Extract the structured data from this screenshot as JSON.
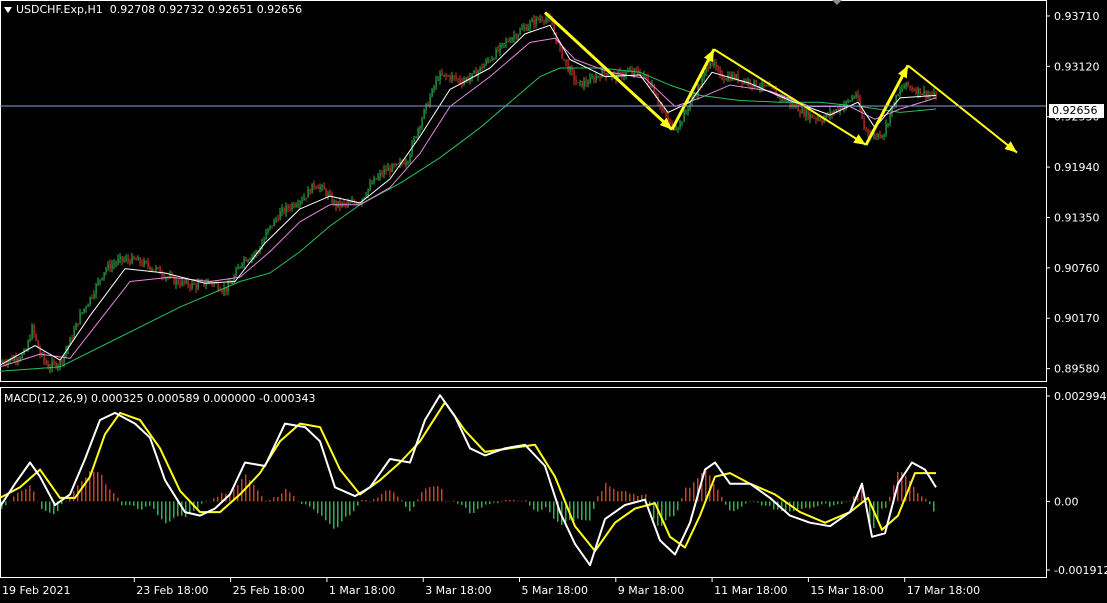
{
  "header": {
    "symbol": "USDCHF.Exp,H1",
    "ohlc": "0.92708 0.92732 0.92651 0.92656"
  },
  "macd_header": "MACD(12,26,9) 0.000325 0.000589 0.000000 -0.000343",
  "current_price": "0.92656",
  "colors": {
    "background": "#000000",
    "grid": "#ffffff",
    "bull_candle": "#2fb34a",
    "bear_candle": "#d43a2a",
    "ma_fast": "#ffffff",
    "ma_pink": "#e58adf",
    "ma_slow": "#25c25a",
    "arrow": "#ffff1a",
    "price_line": "#8a9bd8",
    "macd_line": "#ffffff",
    "signal_line": "#ffff1a"
  },
  "chart_data": [
    {
      "type": "candlestick",
      "title": "",
      "y_ticks": [
        "0.93710",
        "0.93120",
        "0.92530",
        "0.91940",
        "0.91350",
        "0.90760",
        "0.90170",
        "0.89580"
      ],
      "ylim": [
        0.8947,
        0.9385
      ],
      "x_ticks": [
        "19 Feb 2021",
        "23 Feb 18:00",
        "25 Feb 18:00",
        "1 Mar 18:00",
        "3 Mar 18:00",
        "5 Mar 18:00",
        "9 Mar 18:00",
        "11 Mar 18:00",
        "15 Mar 18:00",
        "17 Mar 18:00"
      ],
      "close_path": [
        [
          0,
          0.8965
        ],
        [
          25,
          0.8975
        ],
        [
          32,
          0.9005
        ],
        [
          40,
          0.8975
        ],
        [
          48,
          0.896
        ],
        [
          60,
          0.8965
        ],
        [
          70,
          0.899
        ],
        [
          80,
          0.902
        ],
        [
          92,
          0.9045
        ],
        [
          105,
          0.9075
        ],
        [
          120,
          0.9085
        ],
        [
          135,
          0.9085
        ],
        [
          155,
          0.9075
        ],
        [
          175,
          0.906
        ],
        [
          195,
          0.9055
        ],
        [
          210,
          0.906
        ],
        [
          225,
          0.905
        ],
        [
          232,
          0.906
        ],
        [
          242,
          0.9085
        ],
        [
          258,
          0.9095
        ],
        [
          268,
          0.912
        ],
        [
          280,
          0.914
        ],
        [
          292,
          0.915
        ],
        [
          305,
          0.916
        ],
        [
          315,
          0.9175
        ],
        [
          325,
          0.9165
        ],
        [
          335,
          0.915
        ],
        [
          348,
          0.915
        ],
        [
          360,
          0.9155
        ],
        [
          372,
          0.9175
        ],
        [
          385,
          0.919
        ],
        [
          398,
          0.9195
        ],
        [
          408,
          0.9205
        ],
        [
          418,
          0.924
        ],
        [
          428,
          0.927
        ],
        [
          438,
          0.93
        ],
        [
          450,
          0.93
        ],
        [
          462,
          0.9295
        ],
        [
          472,
          0.93
        ],
        [
          485,
          0.9315
        ],
        [
          498,
          0.933
        ],
        [
          510,
          0.9345
        ],
        [
          522,
          0.9355
        ],
        [
          534,
          0.9365
        ],
        [
          545,
          0.937
        ],
        [
          552,
          0.936
        ],
        [
          560,
          0.933
        ],
        [
          568,
          0.931
        ],
        [
          578,
          0.929
        ],
        [
          590,
          0.9295
        ],
        [
          602,
          0.9305
        ],
        [
          615,
          0.93
        ],
        [
          628,
          0.9305
        ],
        [
          640,
          0.9305
        ],
        [
          652,
          0.929
        ],
        [
          662,
          0.926
        ],
        [
          672,
          0.924
        ],
        [
          680,
          0.9245
        ],
        [
          690,
          0.927
        ],
        [
          700,
          0.929
        ],
        [
          710,
          0.932
        ],
        [
          720,
          0.93
        ],
        [
          732,
          0.93
        ],
        [
          745,
          0.9295
        ],
        [
          758,
          0.929
        ],
        [
          770,
          0.9285
        ],
        [
          782,
          0.9275
        ],
        [
          795,
          0.9265
        ],
        [
          808,
          0.9255
        ],
        [
          822,
          0.925
        ],
        [
          835,
          0.926
        ],
        [
          848,
          0.927
        ],
        [
          856,
          0.928
        ],
        [
          864,
          0.924
        ],
        [
          874,
          0.923
        ],
        [
          884,
          0.9235
        ],
        [
          894,
          0.927
        ],
        [
          904,
          0.929
        ],
        [
          915,
          0.9285
        ],
        [
          926,
          0.928
        ],
        [
          936,
          0.9276
        ]
      ],
      "ma_slow_path": [
        [
          0,
          0.8955
        ],
        [
          60,
          0.896
        ],
        [
          120,
          0.8995
        ],
        [
          180,
          0.903
        ],
        [
          240,
          0.906
        ],
        [
          270,
          0.907
        ],
        [
          300,
          0.9095
        ],
        [
          330,
          0.9125
        ],
        [
          360,
          0.915
        ],
        [
          400,
          0.9175
        ],
        [
          440,
          0.9205
        ],
        [
          480,
          0.924
        ],
        [
          510,
          0.927
        ],
        [
          540,
          0.93
        ],
        [
          560,
          0.931
        ],
        [
          600,
          0.931
        ],
        [
          640,
          0.9305
        ],
        [
          670,
          0.929
        ],
        [
          700,
          0.9278
        ],
        [
          740,
          0.9272
        ],
        [
          780,
          0.927
        ],
        [
          820,
          0.927
        ],
        [
          860,
          0.9265
        ],
        [
          900,
          0.9258
        ],
        [
          936,
          0.9262
        ]
      ],
      "ma_pink_path": [
        [
          0,
          0.896
        ],
        [
          40,
          0.8975
        ],
        [
          70,
          0.897
        ],
        [
          100,
          0.9015
        ],
        [
          130,
          0.906
        ],
        [
          170,
          0.9065
        ],
        [
          210,
          0.906
        ],
        [
          240,
          0.9065
        ],
        [
          270,
          0.9095
        ],
        [
          300,
          0.913
        ],
        [
          330,
          0.915
        ],
        [
          360,
          0.915
        ],
        [
          390,
          0.917
        ],
        [
          420,
          0.921
        ],
        [
          450,
          0.9265
        ],
        [
          490,
          0.93
        ],
        [
          530,
          0.934
        ],
        [
          555,
          0.9345
        ],
        [
          575,
          0.932
        ],
        [
          610,
          0.9305
        ],
        [
          645,
          0.9298
        ],
        [
          675,
          0.9265
        ],
        [
          700,
          0.9275
        ],
        [
          730,
          0.929
        ],
        [
          770,
          0.9283
        ],
        [
          810,
          0.9265
        ],
        [
          850,
          0.9265
        ],
        [
          875,
          0.925
        ],
        [
          900,
          0.9262
        ],
        [
          936,
          0.9275
        ]
      ],
      "ma_white_path": [
        [
          0,
          0.8962
        ],
        [
          35,
          0.8985
        ],
        [
          60,
          0.8968
        ],
        [
          90,
          0.902
        ],
        [
          125,
          0.9075
        ],
        [
          165,
          0.907
        ],
        [
          205,
          0.9058
        ],
        [
          235,
          0.906
        ],
        [
          265,
          0.9105
        ],
        [
          300,
          0.9145
        ],
        [
          330,
          0.916
        ],
        [
          360,
          0.9152
        ],
        [
          390,
          0.918
        ],
        [
          420,
          0.923
        ],
        [
          450,
          0.9285
        ],
        [
          490,
          0.931
        ],
        [
          525,
          0.935
        ],
        [
          550,
          0.936
        ],
        [
          570,
          0.932
        ],
        [
          605,
          0.93
        ],
        [
          640,
          0.9302
        ],
        [
          668,
          0.9258
        ],
        [
          690,
          0.927
        ],
        [
          712,
          0.9305
        ],
        [
          750,
          0.9292
        ],
        [
          790,
          0.9272
        ],
        [
          830,
          0.9255
        ],
        [
          858,
          0.927
        ],
        [
          875,
          0.924
        ],
        [
          900,
          0.9275
        ],
        [
          936,
          0.9278
        ]
      ],
      "arrows": [
        {
          "from": [
            545,
            0.9375
          ],
          "to": [
            672,
            0.9238
          ]
        },
        {
          "from": [
            672,
            0.9238
          ],
          "to": [
            714,
            0.9332
          ]
        },
        {
          "from": [
            714,
            0.9332
          ],
          "to": [
            866,
            0.922
          ]
        },
        {
          "from": [
            866,
            0.922
          ],
          "to": [
            908,
            0.9313
          ]
        },
        {
          "from": [
            908,
            0.9313
          ],
          "to": [
            1017,
            0.9211
          ]
        }
      ]
    },
    {
      "type": "macd",
      "y_ticks": [
        "0.002994",
        "0.00",
        "-0.001912"
      ],
      "ylim": [
        -0.00205,
        0.00312
      ],
      "histogram_step": 4,
      "macd_path": [
        [
          0,
          -0.00015
        ],
        [
          15,
          0.0005
        ],
        [
          30,
          0.0011
        ],
        [
          40,
          0.0007
        ],
        [
          55,
          -0.0001
        ],
        [
          70,
          0.0002
        ],
        [
          85,
          0.0012
        ],
        [
          100,
          0.0023
        ],
        [
          115,
          0.0025
        ],
        [
          135,
          0.0022
        ],
        [
          150,
          0.0018
        ],
        [
          165,
          0.0006
        ],
        [
          185,
          -0.0003
        ],
        [
          200,
          -0.0004
        ],
        [
          215,
          -0.0002
        ],
        [
          230,
          0.0002
        ],
        [
          245,
          0.0011
        ],
        [
          265,
          0.001
        ],
        [
          285,
          0.0022
        ],
        [
          305,
          0.0021
        ],
        [
          320,
          0.0017
        ],
        [
          335,
          0.0004
        ],
        [
          355,
          0.00015
        ],
        [
          370,
          0.0004
        ],
        [
          390,
          0.0012
        ],
        [
          410,
          0.0011
        ],
        [
          425,
          0.0023
        ],
        [
          440,
          0.003
        ],
        [
          455,
          0.0024
        ],
        [
          470,
          0.0015
        ],
        [
          485,
          0.0013
        ],
        [
          505,
          0.0015
        ],
        [
          525,
          0.0016
        ],
        [
          545,
          0.001
        ],
        [
          560,
          -0.0003
        ],
        [
          575,
          -0.0012
        ],
        [
          590,
          -0.0018
        ],
        [
          605,
          -0.0005
        ],
        [
          625,
          -0.0001
        ],
        [
          645,
          5e-05
        ],
        [
          660,
          -0.0011
        ],
        [
          675,
          -0.0015
        ],
        [
          690,
          -0.0006
        ],
        [
          705,
          0.0009
        ],
        [
          715,
          0.0011
        ],
        [
          730,
          0.0005
        ],
        [
          750,
          0.0005
        ],
        [
          770,
          0.0001
        ],
        [
          790,
          -0.0004
        ],
        [
          810,
          -0.0006
        ],
        [
          830,
          -0.0007
        ],
        [
          850,
          -0.0003
        ],
        [
          862,
          0.0005
        ],
        [
          872,
          -0.001
        ],
        [
          885,
          -0.0009
        ],
        [
          898,
          0.0005
        ],
        [
          912,
          0.0011
        ],
        [
          925,
          0.0009
        ],
        [
          936,
          0.0004
        ]
      ],
      "signal_path": [
        [
          0,
          0.0001
        ],
        [
          20,
          0.0004
        ],
        [
          40,
          0.0009
        ],
        [
          60,
          0.0001
        ],
        [
          75,
          0.0001
        ],
        [
          90,
          0.0007
        ],
        [
          105,
          0.0019
        ],
        [
          120,
          0.0025
        ],
        [
          140,
          0.0023
        ],
        [
          160,
          0.0015
        ],
        [
          180,
          0.0003
        ],
        [
          200,
          -0.0003
        ],
        [
          220,
          -0.0003
        ],
        [
          240,
          0.0002
        ],
        [
          260,
          0.0008
        ],
        [
          280,
          0.0017
        ],
        [
          300,
          0.0022
        ],
        [
          320,
          0.0021
        ],
        [
          340,
          0.0009
        ],
        [
          360,
          0.0002
        ],
        [
          380,
          0.0006
        ],
        [
          400,
          0.0011
        ],
        [
          420,
          0.0017
        ],
        [
          445,
          0.0028
        ],
        [
          465,
          0.002
        ],
        [
          485,
          0.0014
        ],
        [
          510,
          0.0015
        ],
        [
          535,
          0.0016
        ],
        [
          555,
          0.0007
        ],
        [
          575,
          -0.0007
        ],
        [
          595,
          -0.0014
        ],
        [
          615,
          -0.0006
        ],
        [
          635,
          -0.0002
        ],
        [
          655,
          -5e-05
        ],
        [
          670,
          -0.001
        ],
        [
          685,
          -0.0013
        ],
        [
          700,
          -0.0004
        ],
        [
          715,
          0.0007
        ],
        [
          730,
          0.0008
        ],
        [
          750,
          0.0005
        ],
        [
          775,
          0.0002
        ],
        [
          800,
          -0.0003
        ],
        [
          825,
          -0.0006
        ],
        [
          850,
          -0.0003
        ],
        [
          868,
          0.0001
        ],
        [
          882,
          -0.0008
        ],
        [
          898,
          -0.0004
        ],
        [
          915,
          0.0008
        ],
        [
          936,
          0.0008
        ]
      ]
    }
  ]
}
